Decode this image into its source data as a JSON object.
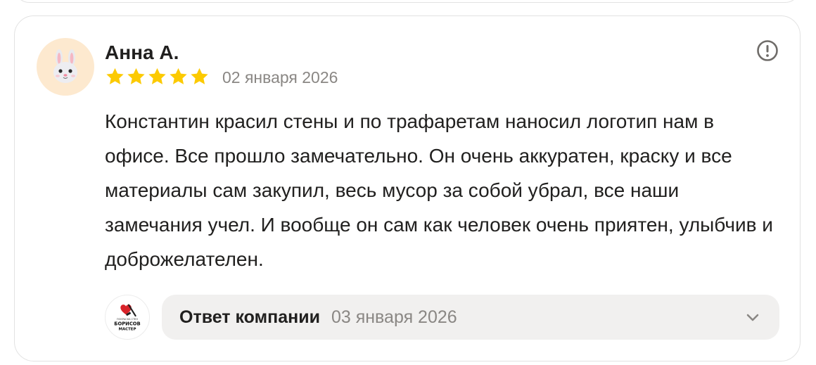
{
  "review": {
    "author": "Анна А.",
    "rating": 5,
    "max_rating": 5,
    "date": "02 января 2026",
    "text": "Константин красил стены и по трафаретам наносил логотип нам в офисе. Все прошло замечательно. Он очень аккуратен, краску и все материалы сам закупил, весь мусор за собой убрал, все наши замечания учел. И вообще он сам как человек очень приятен, улыбчив и доброжелателен."
  },
  "company_reply": {
    "label": "Ответ компании",
    "date": "03 января 2026",
    "logo_text": {
      "top": "ПОКРАСКА СТЕН",
      "line1": "БОРИСОВ",
      "line2": "МАСТЕР"
    }
  },
  "icons": {
    "avatar": "rabbit-face-icon",
    "report": "exclamation-circle-icon",
    "star": "star-icon",
    "expand": "chevron-down-icon"
  },
  "colors": {
    "star": "#fcca00",
    "avatar_bg": "#fde9cf",
    "muted_text": "#8a8784",
    "reply_bg": "#f1f0ef",
    "logo_heart": "#d8232a"
  }
}
